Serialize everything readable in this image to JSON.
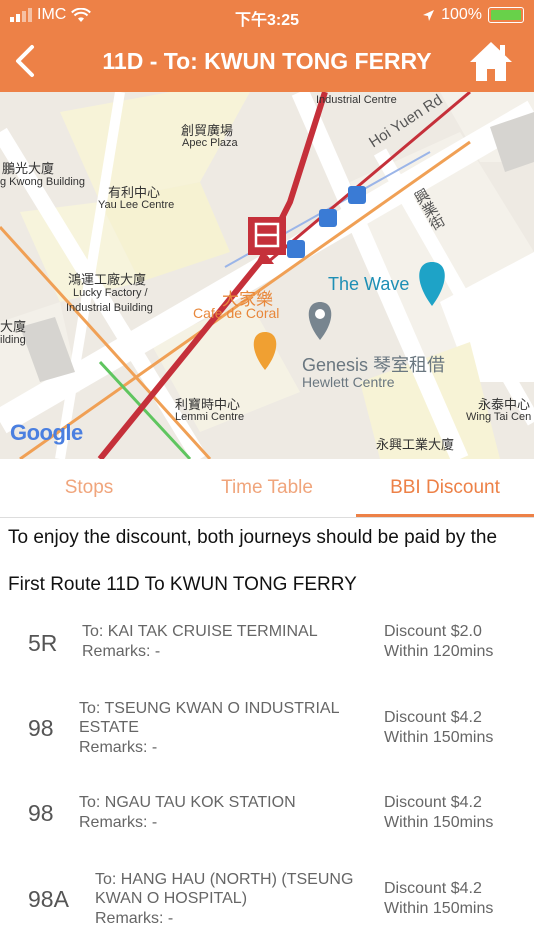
{
  "status_bar": {
    "carrier": "IMC",
    "time": "下午3:25",
    "battery": "100%"
  },
  "header": {
    "title": "11D - To: KWUN TONG FERRY"
  },
  "map_labels": {
    "industrial_centre": "Industrial Centre",
    "apec_cn": "創貿廣場",
    "apec_en": "Apec Plaza",
    "hoi_yuen": "Hoi Yuen Rd",
    "kwong_cn": "鵬光大廈",
    "kwong_en": "g Kwong Building",
    "yaulee_cn": "有利中心",
    "yaulee_en": "Yau Lee Centre",
    "hing_yip": "興業街",
    "lucky_cn": "鴻運工廠大廈",
    "lucky_en1": "Lucky Factory /",
    "lucky_en2": "Industrial Building",
    "cafe_cn": "大家樂",
    "cafe_en": "Cafe de Coral",
    "wave": "The Wave",
    "genesis": "Genesis 琴室租借",
    "hewlett": "Hewlett Centre",
    "left_cn": "大廈",
    "left_en": "ilding",
    "lemmi_cn": "利寶時中心",
    "lemmi_en": "Lemmi Centre",
    "wingtai_cn": "永泰中心",
    "wingtai_en": "Wing Tai Cen",
    "wingyip_cn": "永興工業大廈",
    "google": "Google"
  },
  "tabs": [
    {
      "label": "Stops"
    },
    {
      "label": "Time Table"
    },
    {
      "label": "BBI Discount"
    }
  ],
  "notice": "To enjoy the discount, both journeys should be paid by the",
  "section_title": "First Route 11D To KWUN TONG FERRY",
  "routes": [
    {
      "route": "5R",
      "dest1": "To: KAI TAK CRUISE TERMINAL",
      "dest2": "",
      "remarks": "Remarks:  -",
      "discount": "Discount $2.0",
      "within": "Within 120mins"
    },
    {
      "route": "98",
      "dest1": "To: TSEUNG KWAN O INDUSTRIAL",
      "dest2": "ESTATE",
      "remarks": "Remarks:  -",
      "discount": "Discount $4.2",
      "within": "Within 150mins"
    },
    {
      "route": "98",
      "dest1": "To: NGAU TAU KOK STATION",
      "dest2": "",
      "remarks": "Remarks:  -",
      "discount": "Discount $4.2",
      "within": "Within 150mins"
    },
    {
      "route": "98A",
      "dest1": "To: HANG HAU (NORTH) (TSEUNG",
      "dest2": "KWAN O HOSPITAL)",
      "remarks": "Remarks:  -",
      "discount": "Discount $4.2",
      "within": "Within 150mins"
    }
  ],
  "colors": {
    "brand": "#ed8147",
    "route_line": "#c5303a"
  }
}
